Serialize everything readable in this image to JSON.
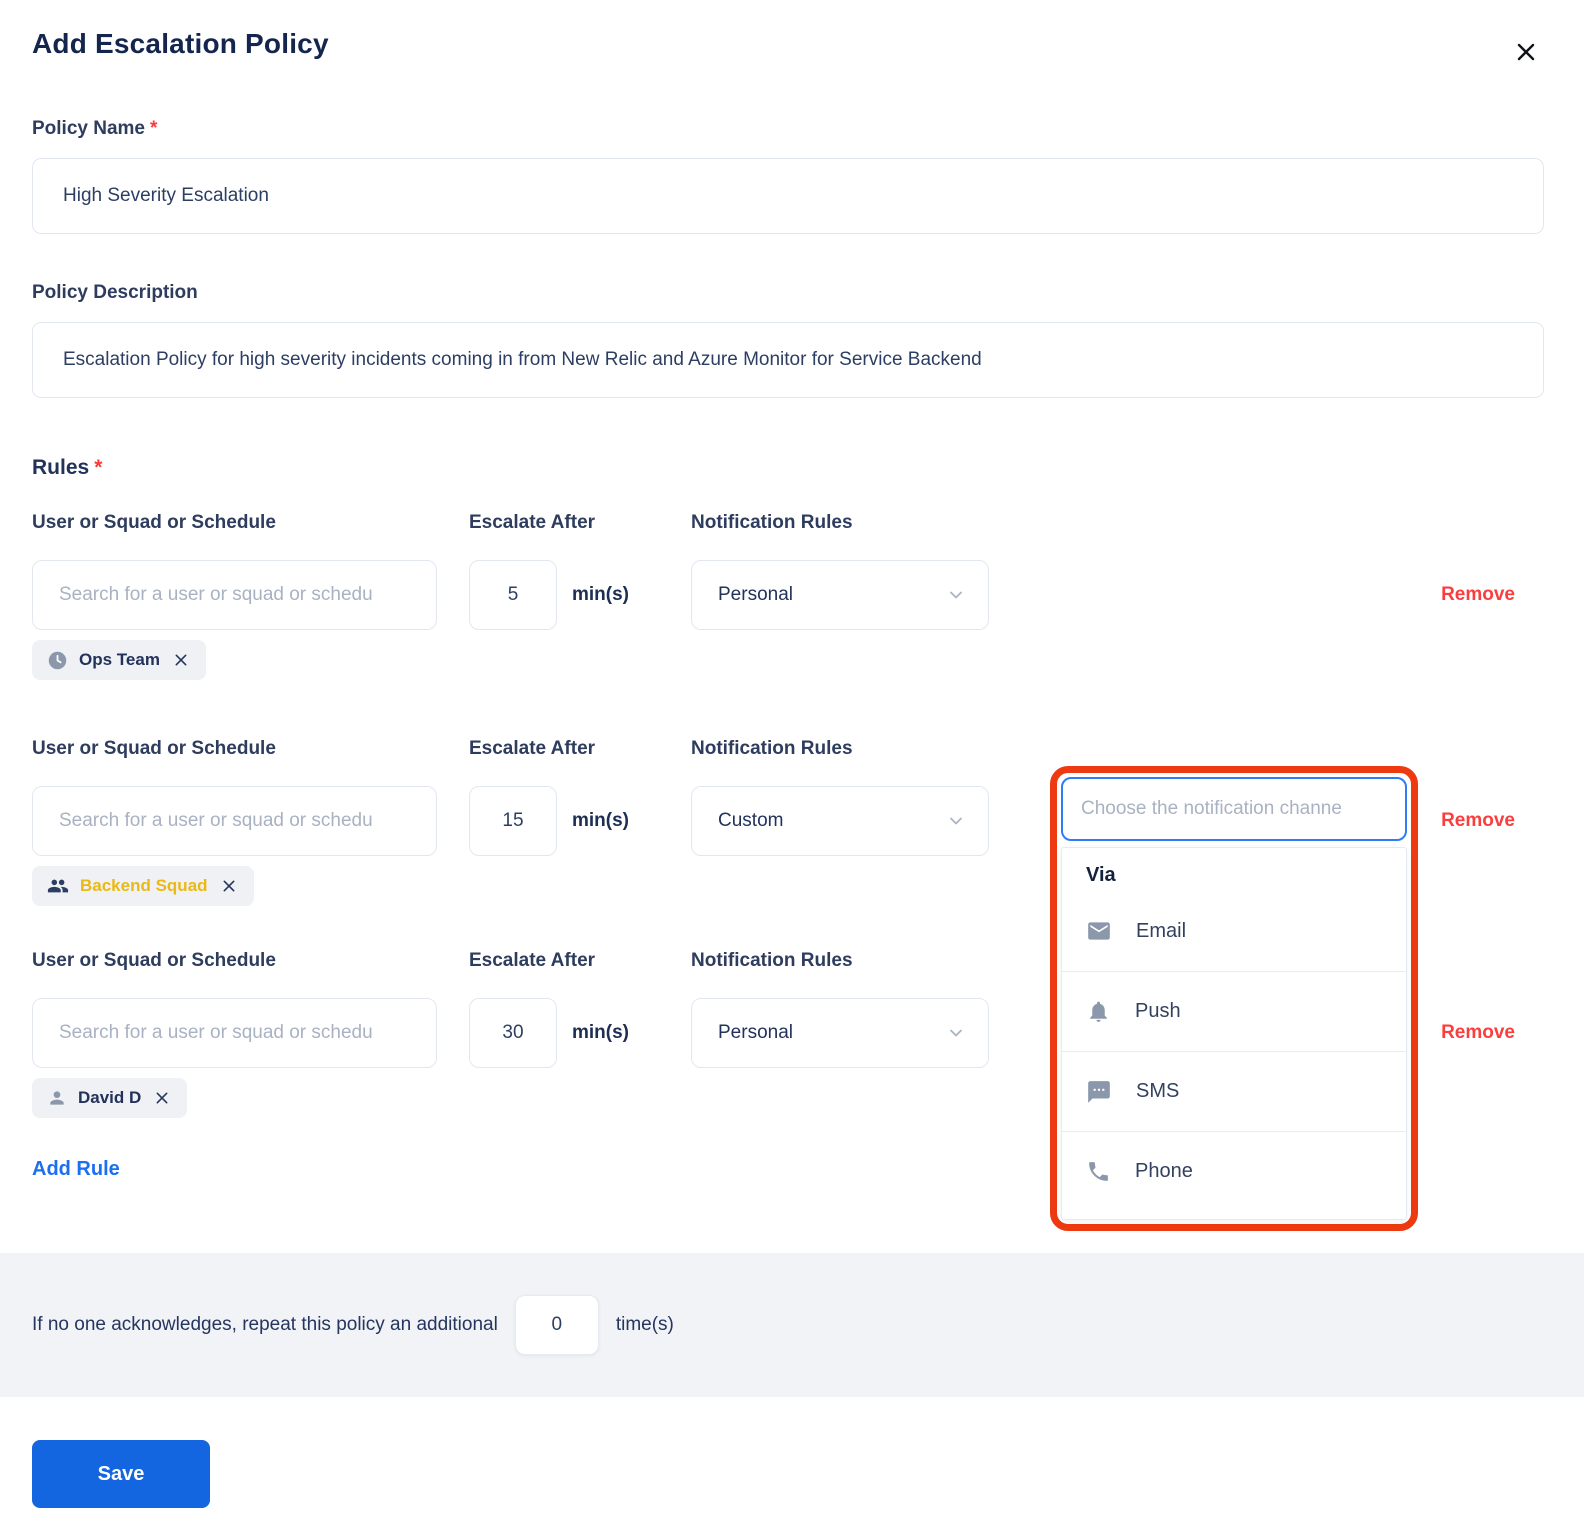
{
  "modal": {
    "title": "Add Escalation Policy"
  },
  "policy_name": {
    "label": "Policy Name",
    "required_mark": "*",
    "value": "High Severity Escalation"
  },
  "policy_description": {
    "label": "Policy Description",
    "value": "Escalation Policy for high severity incidents coming in from New Relic and Azure Monitor for Service Backend"
  },
  "rules_section": {
    "label": "Rules",
    "required_mark": "*",
    "add_rule_label": "Add Rule"
  },
  "columns": {
    "user": "User or Squad or Schedule",
    "escalate": "Escalate After",
    "notification": "Notification Rules"
  },
  "shared": {
    "search_placeholder": "Search for a user or squad or schedu",
    "mins_label": "min(s)",
    "remove_label": "Remove"
  },
  "rules": [
    {
      "escalate_after": "5",
      "notification": "Personal",
      "tag": {
        "name": "Ops Team",
        "icon": "clock-icon"
      }
    },
    {
      "escalate_after": "15",
      "notification": "Custom",
      "tag": {
        "name": "Backend Squad",
        "icon": "squad-icon"
      }
    },
    {
      "escalate_after": "30",
      "notification": "Personal",
      "tag": {
        "name": "David D",
        "icon": "user-icon"
      }
    }
  ],
  "channel_dropdown": {
    "placeholder": "Choose the notification channe",
    "group_label": "Via",
    "options": [
      {
        "label": "Email",
        "icon": "email-icon"
      },
      {
        "label": "Push",
        "icon": "push-bell-icon"
      },
      {
        "label": "SMS",
        "icon": "sms-icon"
      },
      {
        "label": "Phone",
        "icon": "phone-icon"
      }
    ]
  },
  "repeat_footer": {
    "text_before": "If no one acknowledges, repeat this policy an additional",
    "value": "0",
    "text_after": "time(s)"
  },
  "actions": {
    "save_label": "Save"
  },
  "colors": {
    "accent_blue": "#1365e0",
    "link_blue": "#1b6ff0",
    "remove_red": "#fa3e3e",
    "highlight_red": "#ee3a10",
    "tag_yellow": "#eab915",
    "navy_text": "#24355e",
    "focus_blue": "#2f7df6",
    "icon_slate": "#8b98ab",
    "footer_bg": "#f1f3f6"
  }
}
